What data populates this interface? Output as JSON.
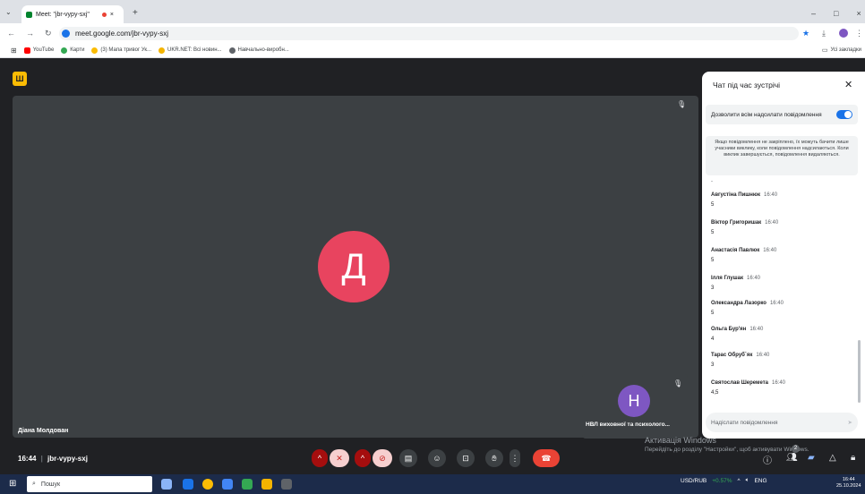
{
  "browser": {
    "tab_title": "Meet: \"jbr-vypy-sxj\"",
    "tab_close": "×",
    "new_tab": "+",
    "url": "meet.google.com/jbr-vypy-sxj",
    "window_controls": [
      "–",
      "□",
      "×"
    ],
    "bookmarks": [
      {
        "label": "YouTube",
        "color": "#ff0000"
      },
      {
        "label": "Карти",
        "color": "#34a853"
      },
      {
        "label": "(3) Мапа тривог Ук...",
        "color": "#fbbc04"
      },
      {
        "label": "UKR.NET: Всі новин...",
        "color": "#f4b400"
      },
      {
        "label": "Навчально-виробн...",
        "color": "#5f6368"
      }
    ],
    "all_bookmarks": "Усі закладки"
  },
  "meet": {
    "logo_glyph": "Ш",
    "main_avatar_letter": "Д",
    "main_participant_name": "Діана Молдован",
    "pip_avatar_letter": "Н",
    "pip_participant_name": "НВЛ виховної та психолого...",
    "time": "16:44",
    "meeting_code": "jbr-vypy-sxj",
    "separator": "|"
  },
  "chat": {
    "title": "Чат під час зустрічі",
    "close_icon": "✕",
    "allow_label": "Дозволити всім надсилати повідомлення",
    "notice": "Якщо повідомлення не закріплено, їх можуть бачити лише учасники виклику, коли повідомлення надсилаються. Коли виклик завершується, повідомлення видаляються.",
    "dash": "-",
    "messages": [
      {
        "name": "Августіна Пишнюк",
        "time": "16:40",
        "text": "5"
      },
      {
        "name": "Віктор Григоришак",
        "time": "16:40",
        "text": "5"
      },
      {
        "name": "Анастасія Павлюк",
        "time": "16:40",
        "text": "5"
      },
      {
        "name": "Ілля Глушак",
        "time": "16:40",
        "text": "3"
      },
      {
        "name": "Олександра Лазорко",
        "time": "16:40",
        "text": "5"
      },
      {
        "name": "Ольга Бур'ян",
        "time": "16:40",
        "text": "4"
      },
      {
        "name": "Тарас Обруб`як",
        "time": "16:40",
        "text": "3"
      },
      {
        "name": "Святослав Шеремета",
        "time": "16:40",
        "text": "4,5"
      }
    ],
    "input_placeholder": "Надіслати повідомлення",
    "send_icon": "➤"
  },
  "watermark": {
    "line1": "Активація Windows",
    "line2": "Перейдіть до розділу \"Настройки\", щоб активувати Windows."
  },
  "participants_badge": "2",
  "taskbar": {
    "search_placeholder": "Пошук",
    "currency": "USD/RUB",
    "currency_change": "+0.57%",
    "lang": "ENG",
    "time": "16:44",
    "date": "25.10.2024"
  }
}
